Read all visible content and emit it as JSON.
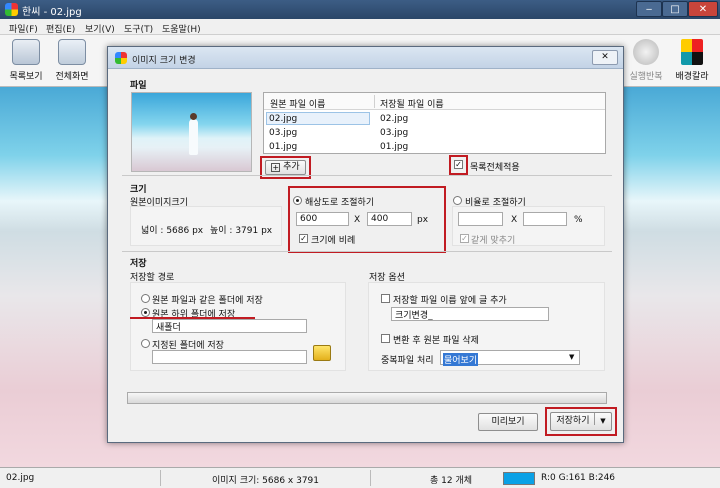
{
  "window": {
    "title": "한씨 - 02.jpg",
    "btn_min": "‒",
    "btn_max": "□",
    "btn_close": "✕"
  },
  "menu": [
    "파일(F)",
    "편집(E)",
    "보기(V)",
    "도구(T)",
    "도움말(H)"
  ],
  "toolbar": {
    "left": [
      {
        "label": "목록보기",
        "icon": "list-icon"
      },
      {
        "label": "전체화면",
        "icon": "fullscreen-icon"
      }
    ],
    "right": [
      {
        "label": "실행반복",
        "icon": "repeat-icon"
      },
      {
        "label": "배경칼라",
        "icon": "palette-icon"
      }
    ]
  },
  "dialog": {
    "title": "이미지 크기 변경",
    "close": "✕",
    "file": {
      "heading": "파일",
      "col_source": "원본 파일 이름",
      "col_target": "저장될 파일 이름",
      "rows": [
        {
          "source": "02.jpg",
          "target": "02.jpg"
        },
        {
          "source": "03.jpg",
          "target": "03.jpg"
        },
        {
          "source": "01.jpg",
          "target": "01.jpg"
        }
      ],
      "add_button": "추가",
      "add_icon": "plus-icon",
      "apply_all_label": "목록전체적용",
      "apply_all_checked": true
    },
    "size": {
      "heading": "크기",
      "original_label": "원본이미지크기",
      "width_text": "넓이 :   5686 px",
      "height_text": "높이 : 3791 px",
      "resolution_label": "해상도로 조절하기",
      "width_value": "600",
      "x_sep": "X",
      "height_value": "400",
      "unit_px": "px",
      "keep_ratio_label": "크기에 비례",
      "keep_ratio_checked": true,
      "ratio_label": "비율로 조절하기",
      "ratio_x_sep": "X",
      "unit_percent": "%",
      "same_label": "같게 맞추기"
    },
    "save": {
      "heading": "저장",
      "path_label": "저장할 경로",
      "opt_same_folder": "원본 파일과 같은 폴더에 저장",
      "opt_subfolder": "원본 하위 폴더에 저장",
      "subfolder_value": "새폴더",
      "opt_specified": "지정된 폴더에 저장",
      "folder_icon": "folder-up-icon",
      "options_label": "저장 옵션",
      "prefix_label": "저장할 파일 이름 앞에 글 추가",
      "prefix_value": "크기변경_",
      "delete_label": "변환 후 원본 파일 삭제",
      "dup_label": "중복파일 처리",
      "dup_value": "물어보기"
    },
    "preview_button": "미리보기",
    "save_button": "저장하기",
    "dropdown_arrow": "▼"
  },
  "status": {
    "file": "02.jpg",
    "size": "이미지 크기: 5686 x 3791",
    "count": "총 12 개체",
    "color_swatch": "#0aa1e6",
    "rgb": "R:0 G:161 B:246"
  }
}
